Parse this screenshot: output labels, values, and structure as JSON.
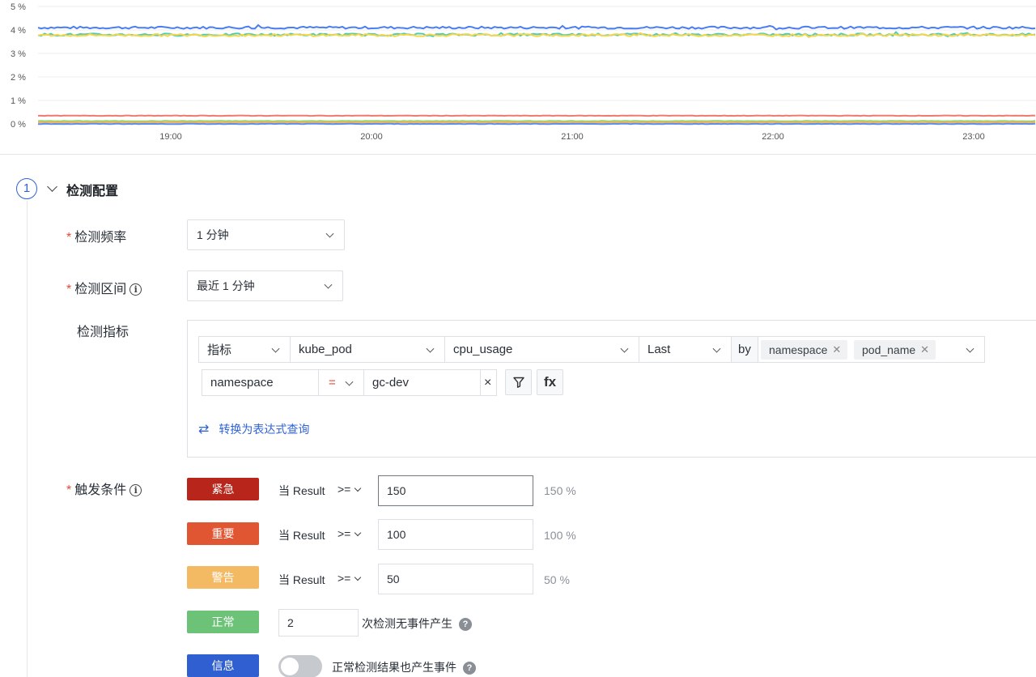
{
  "chart_data": {
    "type": "line",
    "y_ticks": [
      "5 %",
      "4 %",
      "3 %",
      "2 %",
      "1 %",
      "0 %"
    ],
    "x_ticks": [
      "19:00",
      "20:00",
      "21:00",
      "22:00",
      "23:00"
    ],
    "ylim": [
      0,
      5
    ],
    "grid": true,
    "series": [
      {
        "color": "#4a7df0",
        "level": 4.1
      },
      {
        "color": "#4ecdb0",
        "level": 3.8
      },
      {
        "color": "#f5d64a",
        "level": 3.78
      },
      {
        "color": "#f07a6e",
        "level": 0.35
      },
      {
        "color": "#9ad16e",
        "level": 0.12
      },
      {
        "color": "#f5b45a",
        "level": 0.06
      },
      {
        "color": "#5b8ef0",
        "level": 0.0
      }
    ]
  },
  "section": {
    "step": "1",
    "title": "检测配置"
  },
  "freq": {
    "label": "检测频率",
    "value": "1 分钟"
  },
  "range": {
    "label": "检测区间",
    "value": "最近 1 分钟"
  },
  "metric": {
    "label": "检测指标",
    "type": "指标",
    "measurement": "kube_pod",
    "field": "cpu_usage",
    "agg": "Last",
    "by": "by",
    "group_tags": [
      "namespace",
      "pod_name"
    ],
    "filter_key": "namespace",
    "filter_op": "=",
    "filter_value": "gc-dev",
    "filter_clear": "×",
    "fx": "fx",
    "convert": "转换为表达式查询"
  },
  "trigger": {
    "label": "触发条件",
    "rows": [
      {
        "level": "紧急",
        "color": "#b8261b",
        "cond": "当 Result",
        "op": ">=",
        "value": "150",
        "unit": "150 %"
      },
      {
        "level": "重要",
        "color": "#e05532",
        "cond": "当 Result",
        "op": ">=",
        "value": "100",
        "unit": "100 %"
      },
      {
        "level": "警告",
        "color": "#f4b963",
        "cond": "当 Result",
        "op": ">=",
        "value": "50",
        "unit": "50 %"
      }
    ],
    "normal": {
      "level": "正常",
      "color": "#6cc276",
      "value": "2",
      "text": "次检测无事件产生"
    },
    "info": {
      "level": "信息",
      "color": "#2f5fd0",
      "text": "正常检测结果也产生事件"
    }
  }
}
